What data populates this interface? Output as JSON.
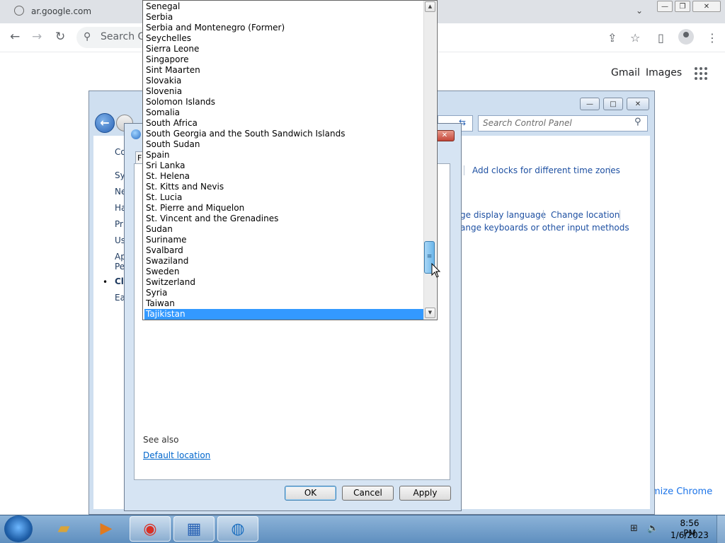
{
  "chrome": {
    "url": "ar.google.com",
    "omnibox_placeholder": "Search Go",
    "gmail": "Gmail",
    "images": "Images",
    "customize": "mize Chrome"
  },
  "control_panel": {
    "search_placeholder": "Search Control Panel",
    "links": {
      "add_clocks": "Add clocks for different time zones",
      "change_display_language": "ge display language",
      "change_location": "Change location",
      "change_keyboards": "ange keyboards or other input methods"
    },
    "sidebar": [
      "Co",
      "Sy",
      "Ne",
      "Ha",
      "Pr",
      "Us",
      "Ap",
      "Pe",
      "Cl",
      "Ea"
    ]
  },
  "dialog": {
    "tab_label": "F",
    "see_also": "See also",
    "default_location": "Default location",
    "ok": "OK",
    "cancel": "Cancel",
    "apply": "Apply"
  },
  "country_list": {
    "items": [
      "Senegal",
      "Serbia",
      "Serbia and Montenegro (Former)",
      "Seychelles",
      "Sierra Leone",
      "Singapore",
      "Sint Maarten",
      "Slovakia",
      "Slovenia",
      "Solomon Islands",
      "Somalia",
      "South Africa",
      "South Georgia and the South Sandwich Islands",
      "South Sudan",
      "Spain",
      "Sri Lanka",
      "St. Helena",
      "St. Kitts and Nevis",
      "St. Lucia",
      "St. Pierre and Miquelon",
      "St. Vincent and the Grenadines",
      "Sudan",
      "Suriname",
      "Svalbard",
      "Swaziland",
      "Sweden",
      "Switzerland",
      "Syria",
      "Taiwan",
      "Tajikistan"
    ],
    "selected": "Tajikistan"
  },
  "taskbar": {
    "time": "8:56 PM",
    "date": "1/6/2023",
    "icons": [
      "start-orb-icon",
      "explorer-icon",
      "media-player-icon",
      "chrome-icon",
      "control-panel-icon",
      "region-globe-icon"
    ]
  }
}
